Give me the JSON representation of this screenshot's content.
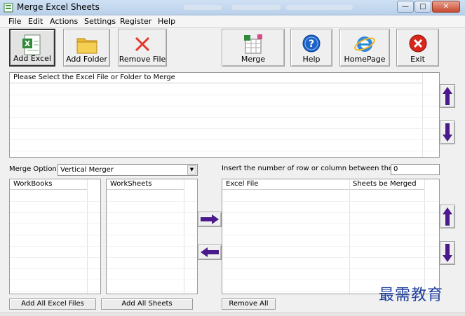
{
  "window": {
    "title": "Merge Excel Sheets"
  },
  "menu": [
    "File",
    "Edit",
    "Actions",
    "Settings",
    "Register",
    "Help"
  ],
  "toolbar": {
    "add_excel": "Add Excel",
    "add_folder": "Add Folder",
    "remove_file": "Remove File",
    "merge": "Merge",
    "help": "Help",
    "homepage": "HomePage",
    "exit": "Exit"
  },
  "file_list": {
    "header": "Please Select the Excel File or Folder to Merge"
  },
  "merge_option": {
    "label": "Merge Option:",
    "value": "Vertical Merger"
  },
  "insert_rows": {
    "label": "Insert the number of row or column between the sheets:",
    "value": "0"
  },
  "workbooks": {
    "header": "WorkBooks"
  },
  "worksheets": {
    "header": "WorkSheets"
  },
  "merge_table": {
    "columns": [
      "Excel File",
      "Sheets be Merged"
    ]
  },
  "buttons": {
    "add_all_excel": "Add All Excel Files",
    "add_all_sheets": "Add All Sheets",
    "remove_all": "Remove All"
  },
  "watermark": "最需教育",
  "colors": {
    "arrow": "#4a1a8c",
    "exit_red": "#d8261b",
    "help_blue": "#1d63c8",
    "remove_red": "#e23a2a"
  }
}
